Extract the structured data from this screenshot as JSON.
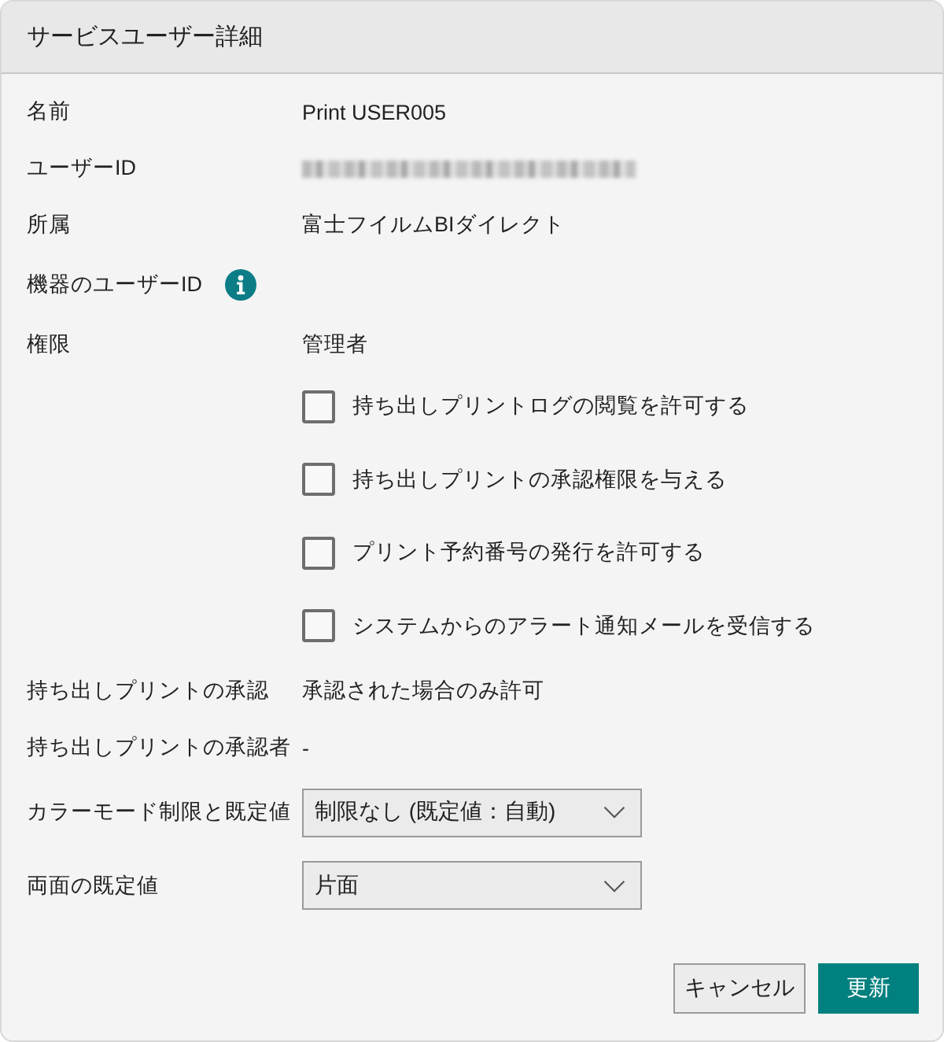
{
  "dialog": {
    "title": "サービスユーザー詳細"
  },
  "fields": [
    {
      "kind": "text",
      "label": "名前",
      "value": "Print USER005"
    },
    {
      "kind": "redacted",
      "label": "ユーザーID"
    },
    {
      "kind": "text",
      "label": "所属",
      "value": "富士フイルムBIダイレクト"
    },
    {
      "kind": "info",
      "label": "機器のユーザーID"
    },
    {
      "kind": "text",
      "label": "権限",
      "value": "管理者"
    },
    {
      "kind": "checkbox",
      "label": "持ち出しプリントログの閲覧を許可する",
      "checked": false
    },
    {
      "kind": "checkbox",
      "label": "持ち出しプリントの承認権限を与える",
      "checked": false
    },
    {
      "kind": "checkbox",
      "label": "プリント予約番号の発行を許可する",
      "checked": false
    },
    {
      "kind": "checkbox",
      "label": "システムからのアラート通知メールを受信する",
      "checked": false
    },
    {
      "kind": "text",
      "label": "持ち出しプリントの承認",
      "value": "承認された場合のみ許可"
    },
    {
      "kind": "text",
      "label": "持ち出しプリントの承認者",
      "value": "-"
    },
    {
      "kind": "select",
      "label": "カラーモード制限と既定値",
      "value": "制限なし (既定値：自動)"
    },
    {
      "kind": "select",
      "label": "両面の既定値",
      "value": "片面"
    }
  ],
  "buttons": [
    {
      "kind": "secondary",
      "label": "キャンセル"
    },
    {
      "kind": "primary",
      "label": "更新"
    }
  ]
}
